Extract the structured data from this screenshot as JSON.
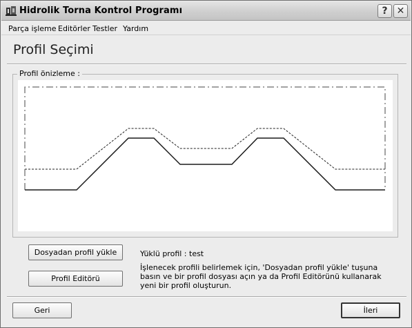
{
  "window": {
    "title": "Hidrolik Torna Kontrol Programı",
    "help_button": "?",
    "close_button": "✕"
  },
  "menu": {
    "items": [
      {
        "label": "Parça işleme"
      },
      {
        "label": "Editörler"
      },
      {
        "label": "Testler"
      },
      {
        "label": "Yardım"
      }
    ]
  },
  "page": {
    "title": "Profil Seçimi"
  },
  "preview": {
    "legend": "Profil önizleme :"
  },
  "actions": {
    "load_button": "Dosyadan profil yükle",
    "editor_button": "Profil Editörü"
  },
  "status": {
    "loaded_profile": "Yüklü profil :  test",
    "instructions": "İşlenecek profili belirlemek için, 'Dosyadan profil yükle' tuşuna basın ve bir profil dosyası açın ya da Profil Editörünü kullanarak yeni bir profil oluşturun."
  },
  "nav": {
    "back_button": "Geri",
    "next_button": "İleri"
  },
  "colors": {
    "window_bg": "#ececec",
    "canvas_bg": "#ffffff",
    "profile_line": "#1a1a1a"
  }
}
